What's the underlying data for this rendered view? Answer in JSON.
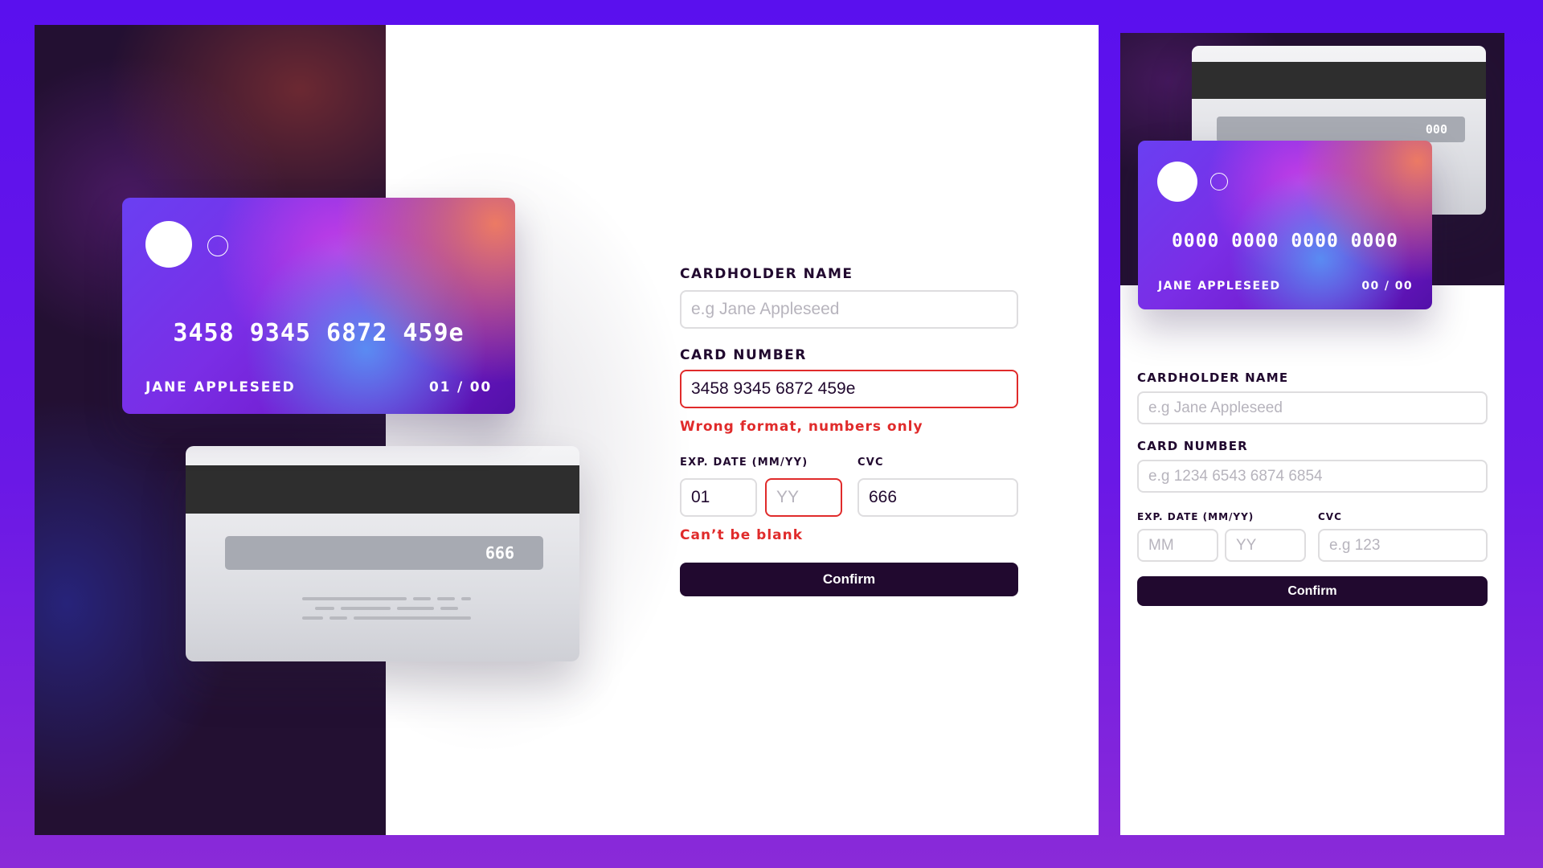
{
  "desktop": {
    "card_front": {
      "number": "3458 9345 6872 459e",
      "name": "JANE APPLESEED",
      "expiry": "01 / 00"
    },
    "card_back": {
      "cvc": "666"
    },
    "form": {
      "cardholder_label": "CARDHOLDER NAME",
      "cardholder_placeholder": "e.g Jane Appleseed",
      "cardholder_value": "",
      "number_label": "CARD NUMBER",
      "number_value": "3458 9345 6872 459e",
      "number_error": "Wrong format, numbers only",
      "exp_label": "EXP. DATE (MM/YY)",
      "mm_value": "01",
      "yy_placeholder": "YY",
      "cvc_label": "CVC",
      "cvc_value": "666",
      "exp_error": "Can’t be blank",
      "confirm": "Confirm"
    }
  },
  "mobile": {
    "card_back": {
      "cvc": "000"
    },
    "card_front": {
      "number": "0000 0000 0000 0000",
      "name": "JANE APPLESEED",
      "expiry": "00 / 00"
    },
    "form": {
      "cardholder_label": "CARDHOLDER NAME",
      "cardholder_placeholder": "e.g Jane Appleseed",
      "number_label": "CARD NUMBER",
      "number_placeholder": "e.g 1234 6543 6874 6854",
      "exp_label": "EXP. DATE (MM/YY)",
      "mm_placeholder": "MM",
      "yy_placeholder": "YY",
      "cvc_label": "CVC",
      "cvc_placeholder": "e.g 123",
      "confirm": "Confirm"
    }
  },
  "colors": {
    "background": "#5a10ee",
    "dark": "#21092f",
    "error": "#e02b2b",
    "input_border": "#dedddf"
  }
}
